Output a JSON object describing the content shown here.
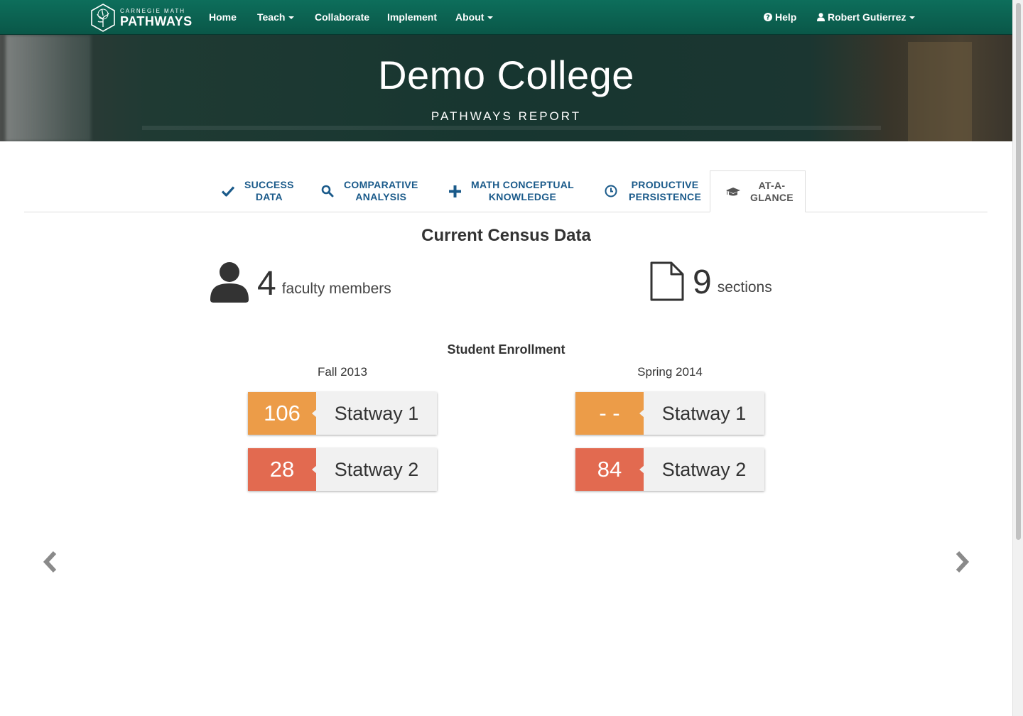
{
  "navbar": {
    "logo_small": "CARNEGIE MATH",
    "logo_big": "PATHWAYS",
    "items": [
      {
        "label": "Home"
      },
      {
        "label": "Teach"
      },
      {
        "label": "Collaborate"
      },
      {
        "label": "Implement"
      },
      {
        "label": "About"
      }
    ],
    "help_label": "Help",
    "user_label": "Robert Gutierrez",
    "color": "#0b6352"
  },
  "hero": {
    "title": "Demo College",
    "subtitle": "PATHWAYS REPORT"
  },
  "tabs": [
    {
      "line1": "SUCCESS",
      "line2": "DATA",
      "icon": "check-icon"
    },
    {
      "line1": "COMPARATIVE",
      "line2": "ANALYSIS",
      "icon": "search-icon"
    },
    {
      "line1": "MATH CONCEPTUAL",
      "line2": "KNOWLEDGE",
      "icon": "plus-icon"
    },
    {
      "line1": "PRODUCTIVE",
      "line2": "PERSISTENCE",
      "icon": "clock-icon"
    },
    {
      "line1": "AT-A-",
      "line2": "GLANCE",
      "icon": "graduation-cap-icon",
      "active": true
    }
  ],
  "census": {
    "title": "Current Census Data",
    "faculty_count": "4",
    "faculty_label": "faculty members",
    "sections_count": "9",
    "sections_label": "sections"
  },
  "enrollment": {
    "title": "Student Enrollment",
    "terms": [
      {
        "name": "Fall 2013",
        "courses": [
          {
            "count": "106",
            "name": "Statway 1"
          },
          {
            "count": "28",
            "name": "Statway 2"
          }
        ]
      },
      {
        "name": "Spring 2014",
        "courses": [
          {
            "count": "- -",
            "name": "Statway 1"
          },
          {
            "count": "84",
            "name": "Statway 2"
          }
        ]
      }
    ]
  },
  "colors": {
    "tab_text": "#1a5a8a",
    "orange": "#ec9c48",
    "red": "#e26a50"
  }
}
